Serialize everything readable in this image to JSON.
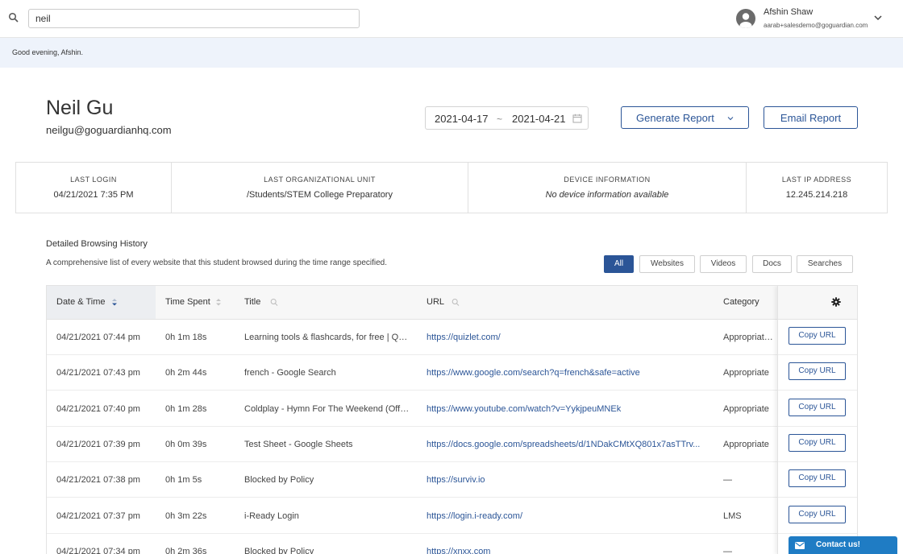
{
  "search": {
    "value": "neil"
  },
  "user": {
    "name": "Afshin Shaw",
    "email": "aarab+salesdemo@goguardian.com"
  },
  "greeting": "Good evening, Afshin.",
  "student": {
    "name": "Neil Gu",
    "email": "neilgu@goguardianhq.com"
  },
  "date_range": {
    "start": "2021-04-17",
    "separator": "~",
    "end": "2021-04-21"
  },
  "actions": {
    "generate_report": "Generate Report",
    "email_report": "Email Report"
  },
  "info": [
    {
      "label": "LAST LOGIN",
      "value": "04/21/2021 7:35 PM"
    },
    {
      "label": "LAST ORGANIZATIONAL UNIT",
      "value": "/Students/STEM College Preparatory"
    },
    {
      "label": "DEVICE INFORMATION",
      "value": "No device information available"
    },
    {
      "label": "LAST IP ADDRESS",
      "value": "12.245.214.218"
    }
  ],
  "history": {
    "title": "Detailed Browsing History",
    "description": "A comprehensive list of every website that this student browsed during the time range specified.",
    "filters": [
      "All",
      "Websites",
      "Videos",
      "Docs",
      "Searches"
    ],
    "active_filter": "All"
  },
  "table": {
    "columns": [
      "Date & Time",
      "Time Spent",
      "Title",
      "URL",
      "Category"
    ],
    "copy_label": "Copy URL",
    "rows": [
      {
        "datetime": "04/21/2021 07:44 pm",
        "time_spent": "0h 1m 18s",
        "title": "Learning tools & flashcards, for free | Quizlet",
        "url": "https://quizlet.com/",
        "category": "Appropriate, Education"
      },
      {
        "datetime": "04/21/2021 07:43 pm",
        "time_spent": "0h 2m 44s",
        "title": "french - Google Search",
        "url": "https://www.google.com/search?q=french&safe=active",
        "category": "Appropriate"
      },
      {
        "datetime": "04/21/2021 07:40 pm",
        "time_spent": "0h 1m 28s",
        "title": "Coldplay - Hymn For The Weekend (Official Video)",
        "url": "https://www.youtube.com/watch?v=YykjpeuMNEk",
        "category": "Appropriate"
      },
      {
        "datetime": "04/21/2021 07:39 pm",
        "time_spent": "0h 0m 39s",
        "title": "Test Sheet - Google Sheets",
        "url": "https://docs.google.com/spreadsheets/d/1NDakCMtXQ801x7asTTrv...",
        "category": "Appropriate"
      },
      {
        "datetime": "04/21/2021 07:38 pm",
        "time_spent": "0h 1m 5s",
        "title": "Blocked by Policy",
        "url": "https://surviv.io",
        "category": "—"
      },
      {
        "datetime": "04/21/2021 07:37 pm",
        "time_spent": "0h 3m 22s",
        "title": "i-Ready Login",
        "url": "https://login.i-ready.com/",
        "category": "LMS"
      },
      {
        "datetime": "04/21/2021 07:34 pm",
        "time_spent": "0h 2m 36s",
        "title": "Blocked by Policy",
        "url": "https://xnxx.com",
        "category": "—"
      }
    ]
  },
  "contact": {
    "label": "Contact us!"
  },
  "colors": {
    "primary": "#2b5597",
    "greeting_bg": "#eef3fb",
    "contact": "#1f7cc4"
  }
}
